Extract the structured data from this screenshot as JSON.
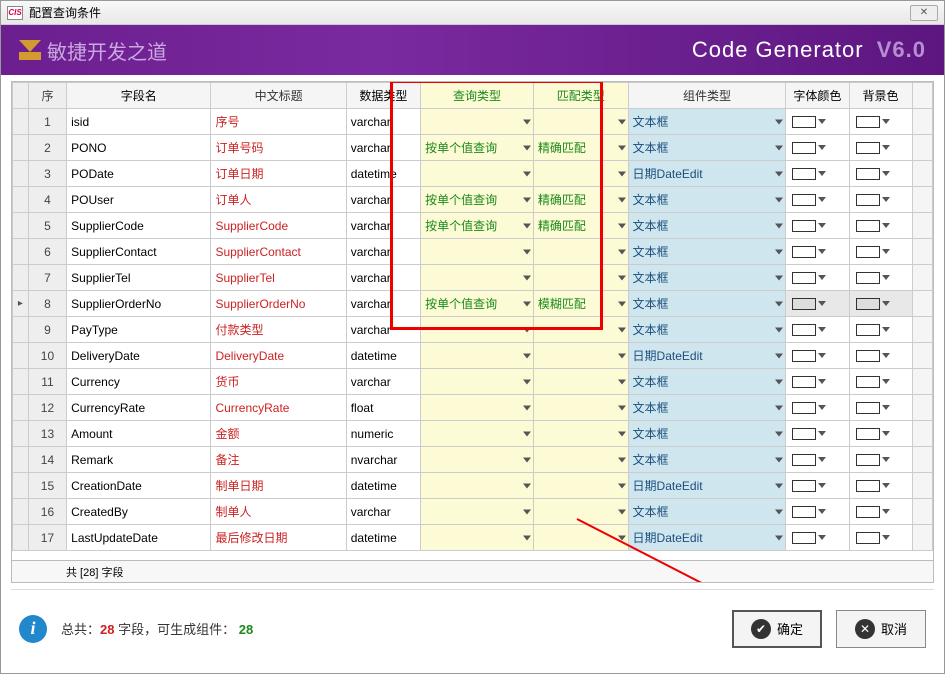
{
  "window": {
    "title": "配置查询条件",
    "app_icon_text": "CIS"
  },
  "banner": {
    "slogan": "敏捷开发之道",
    "brand": "Code Generator",
    "version": "V6.0"
  },
  "columns": {
    "seq": "序",
    "field": "字段名",
    "caption": "中文标题",
    "datatype": "数据类型",
    "querytype": "查询类型",
    "matchtype": "匹配类型",
    "widget": "组件类型",
    "fontcolor": "字体颜色",
    "bgcolor": "背景色"
  },
  "rows": [
    {
      "seq": 1,
      "field": "isid",
      "caption": "序号",
      "dtype": "varchar",
      "query": "",
      "match": "",
      "widget": "文本框"
    },
    {
      "seq": 2,
      "field": "PONO",
      "caption": "订单号码",
      "dtype": "varchar",
      "query": "按单个值查询",
      "match": "精确匹配",
      "widget": "文本框"
    },
    {
      "seq": 3,
      "field": "PODate",
      "caption": "订单日期",
      "dtype": "datetime",
      "query": "",
      "match": "",
      "widget": "日期DateEdit"
    },
    {
      "seq": 4,
      "field": "POUser",
      "caption": "订单人",
      "dtype": "varchar",
      "query": "按单个值查询",
      "match": "精确匹配",
      "widget": "文本框"
    },
    {
      "seq": 5,
      "field": "SupplierCode",
      "caption": "SupplierCode",
      "dtype": "varchar",
      "query": "按单个值查询",
      "match": "精确匹配",
      "widget": "文本框"
    },
    {
      "seq": 6,
      "field": "SupplierContact",
      "caption": "SupplierContact",
      "dtype": "varchar",
      "query": "",
      "match": "",
      "widget": "文本框"
    },
    {
      "seq": 7,
      "field": "SupplierTel",
      "caption": "SupplierTel",
      "dtype": "varchar",
      "query": "",
      "match": "",
      "widget": "文本框"
    },
    {
      "seq": 8,
      "field": "SupplierOrderNo",
      "caption": "SupplierOrderNo",
      "dtype": "varchar",
      "query": "按单个值查询",
      "match": "模糊匹配",
      "widget": "文本框",
      "current": true
    },
    {
      "seq": 9,
      "field": "PayType",
      "caption": "付款类型",
      "dtype": "varchar",
      "query": "",
      "match": "",
      "widget": "文本框"
    },
    {
      "seq": 10,
      "field": "DeliveryDate",
      "caption": "DeliveryDate",
      "dtype": "datetime",
      "query": "",
      "match": "",
      "widget": "日期DateEdit"
    },
    {
      "seq": 11,
      "field": "Currency",
      "caption": "货币",
      "dtype": "varchar",
      "query": "",
      "match": "",
      "widget": "文本框"
    },
    {
      "seq": 12,
      "field": "CurrencyRate",
      "caption": "CurrencyRate",
      "dtype": "float",
      "query": "",
      "match": "",
      "widget": "文本框"
    },
    {
      "seq": 13,
      "field": "Amount",
      "caption": "金额",
      "dtype": "numeric",
      "query": "",
      "match": "",
      "widget": "文本框"
    },
    {
      "seq": 14,
      "field": "Remark",
      "caption": "备注",
      "dtype": "nvarchar",
      "query": "",
      "match": "",
      "widget": "文本框"
    },
    {
      "seq": 15,
      "field": "CreationDate",
      "caption": "制单日期",
      "dtype": "datetime",
      "query": "",
      "match": "",
      "widget": "日期DateEdit"
    },
    {
      "seq": 16,
      "field": "CreatedBy",
      "caption": "制单人",
      "dtype": "varchar",
      "query": "",
      "match": "",
      "widget": "文本框"
    },
    {
      "seq": 17,
      "field": "LastUpdateDate",
      "caption": "最后修改日期",
      "dtype": "datetime",
      "query": "",
      "match": "",
      "widget": "日期DateEdit"
    }
  ],
  "summary": {
    "text": "共 [28] 字段"
  },
  "footer": {
    "total_label_a": "总共：",
    "total_count": "28",
    "total_label_b": " 字段，可生成组件：",
    "gen_count": "28",
    "ok": "确定",
    "cancel": "取消"
  }
}
